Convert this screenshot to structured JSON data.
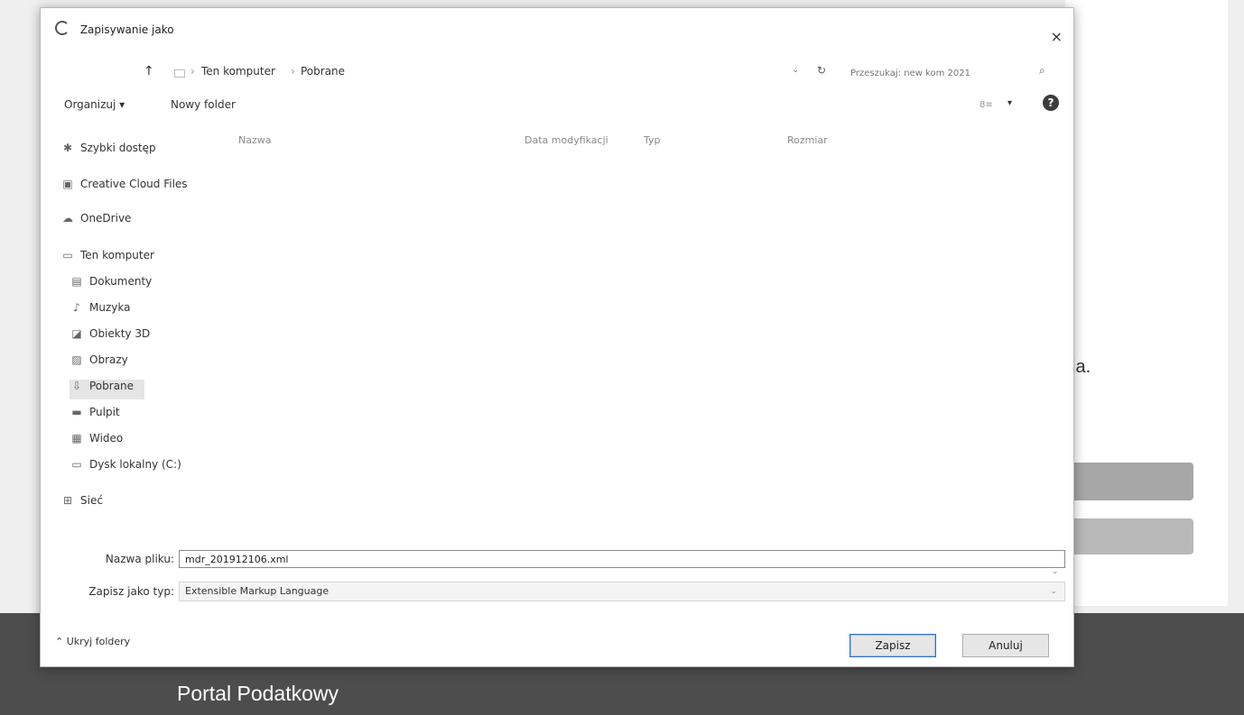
{
  "dialog": {
    "title": "Zapisywanie jako",
    "close_label": "×"
  },
  "address": {
    "up_label": "↑",
    "path": [
      "Ten komputer",
      "Pobrane"
    ],
    "separator": "›",
    "refresh_label": "↻",
    "search_placeholder": "Przeszukaj: new kom 2021"
  },
  "toolbar": {
    "organize_label": "Organizuj ▾",
    "new_folder_label": "Nowy folder",
    "view_label": "8≡",
    "view_dd": "▾",
    "help_label": "?"
  },
  "columns": {
    "name": "Nazwa",
    "date": "Data modyfikacji",
    "type": "Typ",
    "size": "Rozmiar"
  },
  "nav": {
    "quick_access": "Szybki dostęp",
    "creative_cloud": "Creative Cloud Files",
    "onedrive": "OneDrive",
    "this_pc": "Ten komputer",
    "documents": "Dokumenty",
    "music": "Muzyka",
    "objects3d": "Obiekty 3D",
    "pictures": "Obrazy",
    "downloads": "Pobrane",
    "desktop": "Pulpit",
    "videos": "Wideo",
    "local_disk": "Dysk lokalny (C:)",
    "network": "Sieć"
  },
  "form": {
    "filename_label": "Nazwa pliku:",
    "filename_value": "mdr_201912106.xml",
    "filetype_label": "Zapisz jako typ:",
    "filetype_value": "Extensible Markup Language",
    "dropdown_glyph": "⌄"
  },
  "footer_controls": {
    "hide_folders_label": "⌃ Ukryj foldery",
    "save_label": "Zapisz",
    "cancel_label": "Anuluj"
  },
  "background": {
    "partial_text": "ia.",
    "portal_title": "Portal Podatkowy"
  }
}
